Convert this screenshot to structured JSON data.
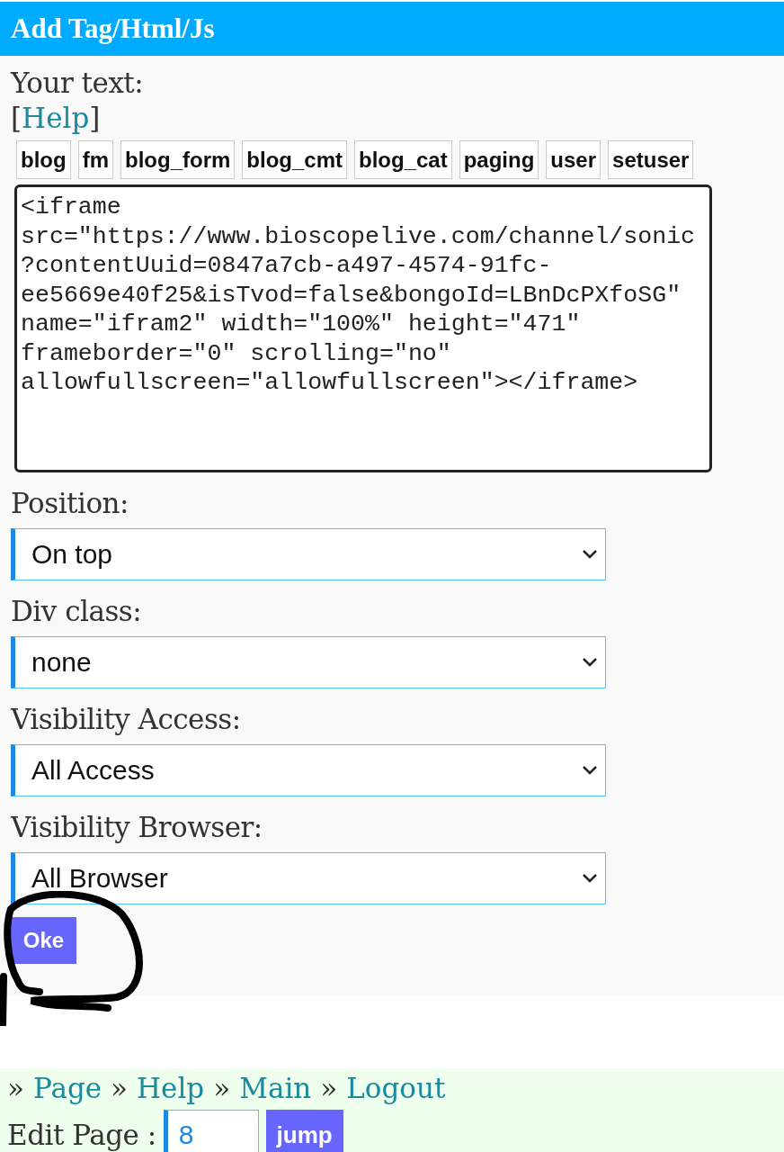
{
  "header": {
    "title": "Add Tag/Html/Js"
  },
  "text_label": "Your text:",
  "help": {
    "open": "[",
    "link": "Help",
    "close": "]"
  },
  "tag_buttons": [
    "blog",
    "fm",
    "blog_form",
    "blog_cmt",
    "blog_cat",
    "paging",
    "user",
    "setuser"
  ],
  "code_field": {
    "value": "<iframe src=\"https://www.bioscopelive.com/channel/sonic?contentUuid=0847a7cb-a497-4574-91fc-ee5669e40f25&isTvod=false&bongoId=LBnDcPXfoSG\" name=\"ifram2\" width=\"100%\" height=\"471\" frameborder=\"0\" scrolling=\"no\" allowfullscreen=\"allowfullscreen\"></iframe>"
  },
  "fields": [
    {
      "label": "Position:",
      "value": "On top"
    },
    {
      "label": "Div class:",
      "value": "none"
    },
    {
      "label": "Visibility Access:",
      "value": "All Access"
    },
    {
      "label": "Visibility Browser:",
      "value": "All Browser"
    }
  ],
  "ok_button": "Oke",
  "footer": {
    "nav": [
      {
        "sep": "»",
        "link": "Page"
      },
      {
        "sep": "»",
        "link": "Help"
      },
      {
        "sep": "»",
        "link": "Main"
      },
      {
        "sep": "»",
        "link": "Logout"
      }
    ],
    "edit_label": "Edit Page :",
    "page_value": "8",
    "jump_button": "jump"
  }
}
